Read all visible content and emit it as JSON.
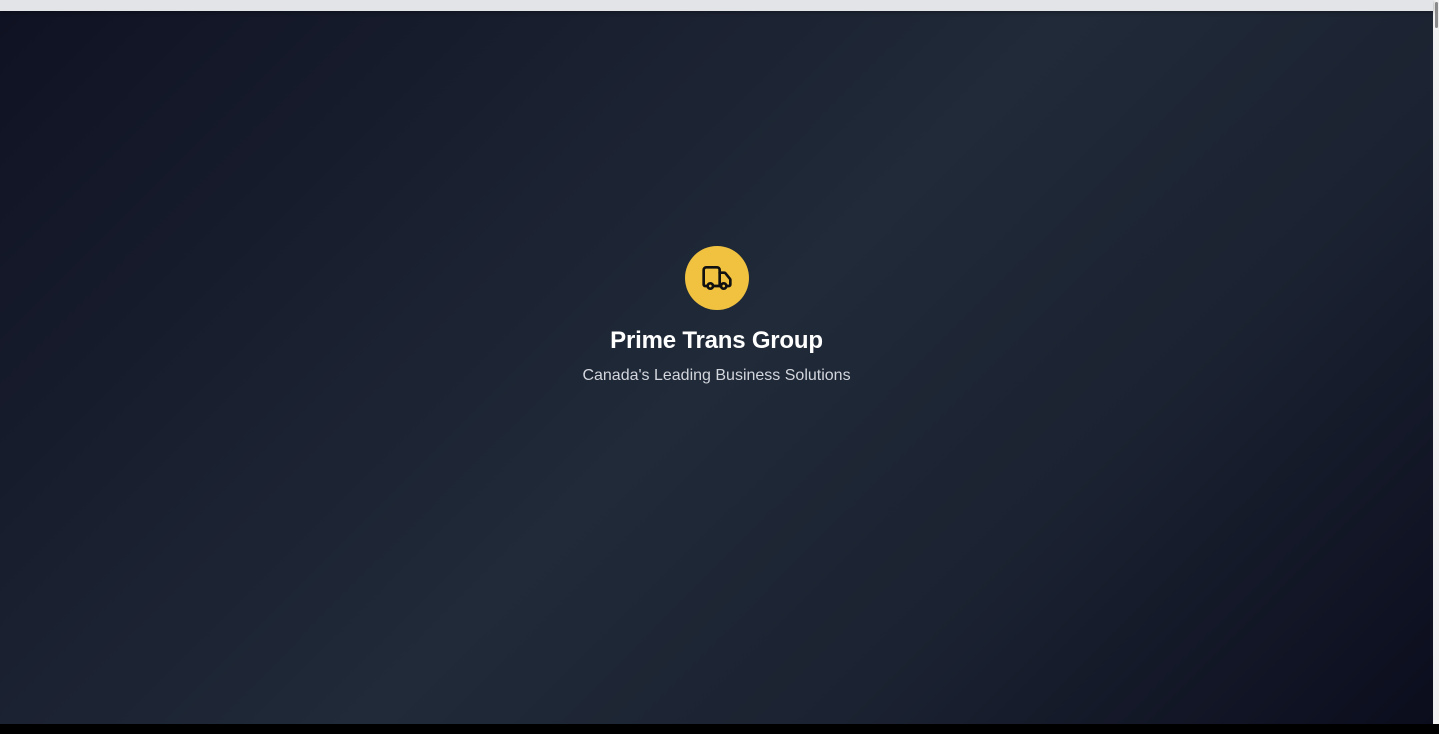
{
  "splash": {
    "logo_icon": "truck-icon",
    "title": "Prime Trans Group",
    "tagline": "Canada's Leading Business Solutions"
  },
  "colors": {
    "accent": "#f0c240",
    "background_dark": "#0f1222",
    "background_mid": "#202a38",
    "title_text": "#ffffff",
    "tagline_text": "#d3d6dd"
  }
}
